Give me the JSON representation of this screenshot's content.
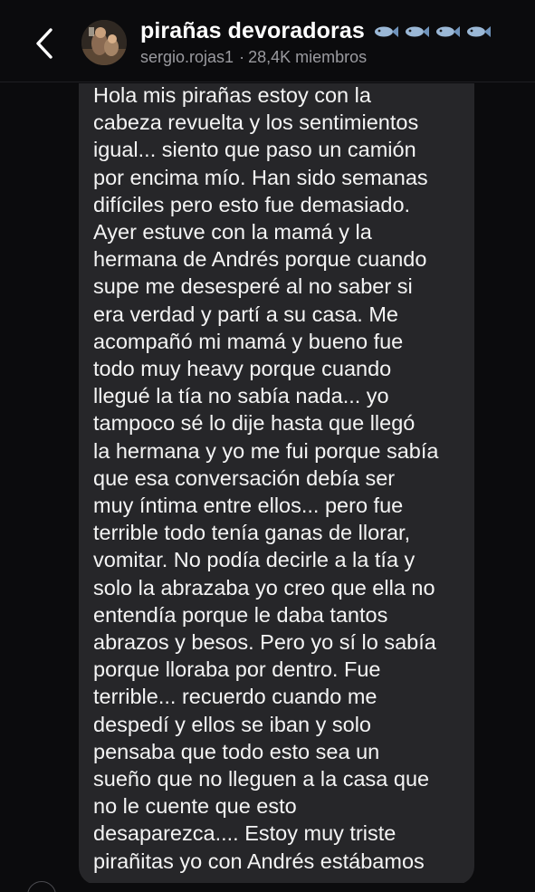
{
  "header": {
    "title": "pirañas devoradoras",
    "title_icons": [
      "fish-icon",
      "fish-icon",
      "fish-icon",
      "fish-icon"
    ],
    "author": "sergio.rojas1",
    "separator": "·",
    "members": "28,4K miembros",
    "back_icon": "chevron-left-icon"
  },
  "message": {
    "text": "Hola mis pirañas estoy con la\ncabeza revuelta y los sentimientos\nigual... siento que paso un camión\npor encima mío. Han sido semanas\ndifíciles pero esto fue demasiado.\nAyer estuve con la mamá y la\nhermana de Andrés porque cuando\nsupe me desesperé al no saber si\nera verdad y partí a su casa. Me\nacompañó mi mamá y bueno fue\ntodo muy heavy porque cuando\nllegué la tía no sabía nada... yo\ntampoco sé lo dije hasta que llegó\nla hermana y yo me fui porque sabía\nque esa conversación debía ser\nmuy íntima entre ellos... pero fue\nterrible todo tenía ganas de llorar,\nvomitar. No podía decirle a la tía y\nsolo la abrazaba yo creo que ella no\nentendía porque le daba tantos\nabrazos y besos. Pero yo sí lo sabía\nporque lloraba por dentro. Fue\nterrible... recuerdo cuando me\ndespedí y ellos se iban y solo\npensaba que todo esto sea un\nsueño que no lleguen a la casa que\nno le cuente que esto\ndesaparezca.... Estoy muy triste\npirañitas yo con Andrés estábamos"
  },
  "colors": {
    "background": "#0b0b0d",
    "bubble": "#262629",
    "text": "#f4f4f4",
    "muted": "#9a9a9f",
    "fish": "#9bb8d6"
  }
}
